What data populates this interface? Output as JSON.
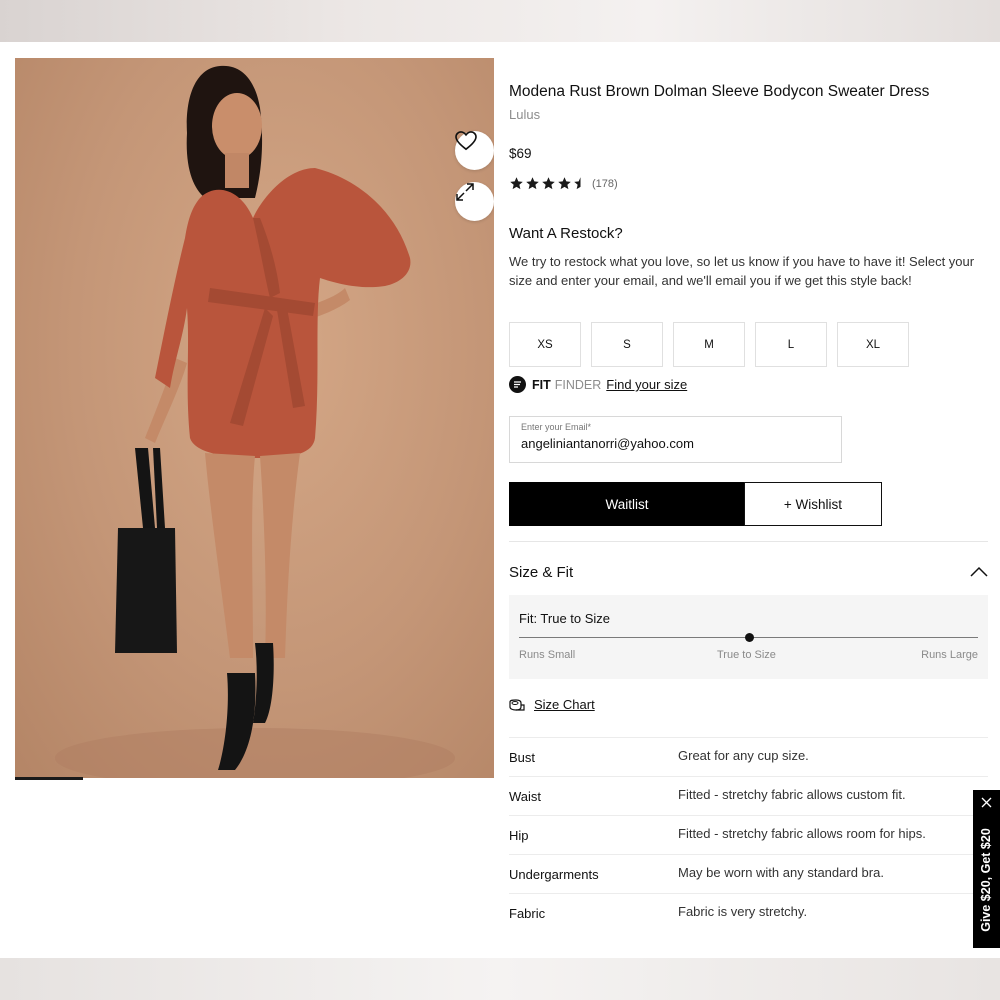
{
  "product": {
    "title": "Modena Rust Brown Dolman Sleeve Bodycon Sweater Dress",
    "brand": "Lulus",
    "price": "$69",
    "rating_value": 4.5,
    "rating_count": "(178)"
  },
  "restock": {
    "heading": "Want A Restock?",
    "description": "We try to restock what you love, so let us know if you have to have it! Select your size and enter your email, and we'll email you if we get this style back!"
  },
  "sizes": [
    "XS",
    "S",
    "M",
    "L",
    "XL"
  ],
  "fit_finder": {
    "fit": "FIT",
    "finder": "FINDER",
    "link": "Find your size"
  },
  "email": {
    "label": "Enter your Email*",
    "value": "angeliniantanorri@yahoo.com"
  },
  "actions": {
    "waitlist": "Waitlist",
    "wishlist": "+ Wishlist"
  },
  "size_fit": {
    "heading": "Size & Fit",
    "fit_label": "Fit: True to Size",
    "fit_position": 0.5,
    "scale": [
      "Runs Small",
      "True to Size",
      "Runs Large"
    ],
    "size_chart": "Size Chart",
    "specs": [
      {
        "key": "Bust",
        "value": "Great for any cup size."
      },
      {
        "key": "Waist",
        "value": "Fitted - stretchy fabric allows custom fit."
      },
      {
        "key": "Hip",
        "value": "Fitted - stretchy fabric allows room for hips."
      },
      {
        "key": "Undergarments",
        "value": "May be worn with any standard bra."
      },
      {
        "key": "Fabric",
        "value": "Fabric is very stretchy."
      }
    ]
  },
  "promo": {
    "text": "Give $20, Get $20"
  },
  "icons": {
    "wishlist": "heart-icon",
    "expand": "expand-icon",
    "collapse": "chevron-up-icon",
    "size_chart": "size-chart-icon",
    "close": "close-icon",
    "fit_finder": "fit-finder-logo-icon"
  },
  "colors": {
    "primary": "#000000",
    "dress": "#b9553c",
    "background": "#c49677"
  }
}
